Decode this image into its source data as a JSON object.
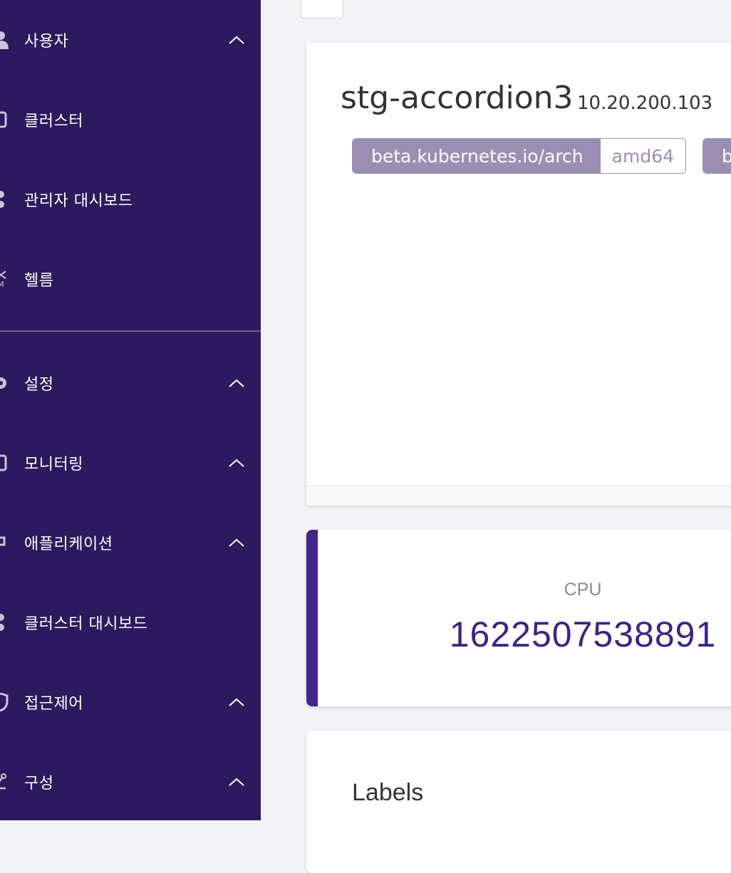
{
  "sidebar": {
    "items": [
      {
        "label": "사용자",
        "icon": "user-icon",
        "expandable": true
      },
      {
        "label": "클러스터",
        "icon": "cluster-icon",
        "expandable": false
      },
      {
        "label": "관리자 대시보드",
        "icon": "dashboard-icon",
        "expandable": false
      },
      {
        "label": "헬름",
        "icon": "helm-icon",
        "expandable": false
      },
      {
        "label": "설정",
        "icon": "gear-icon",
        "expandable": true
      },
      {
        "label": "모니터링",
        "icon": "monitor-icon",
        "expandable": true
      },
      {
        "label": "애플리케이션",
        "icon": "application-icon",
        "expandable": true
      },
      {
        "label": "클러스터 대시보드",
        "icon": "dashboard-icon",
        "expandable": false
      },
      {
        "label": "접근제어",
        "icon": "shield-icon",
        "expandable": true
      },
      {
        "label": "구성",
        "icon": "config-icon",
        "expandable": true
      }
    ]
  },
  "node": {
    "name": "stg-accordion3",
    "ip": "10.20.200.103",
    "labels": [
      {
        "key": "beta.kubernetes.io/arch",
        "value": "amd64"
      },
      {
        "key": "b",
        "value": ""
      }
    ]
  },
  "cpu": {
    "title": "CPU",
    "value": "1622507538891"
  },
  "labels_section": {
    "title": "Labels"
  },
  "colors": {
    "sidebar_bg": "#2c1a5e",
    "accent": "#42268a",
    "chip": "#9a8fb3"
  }
}
